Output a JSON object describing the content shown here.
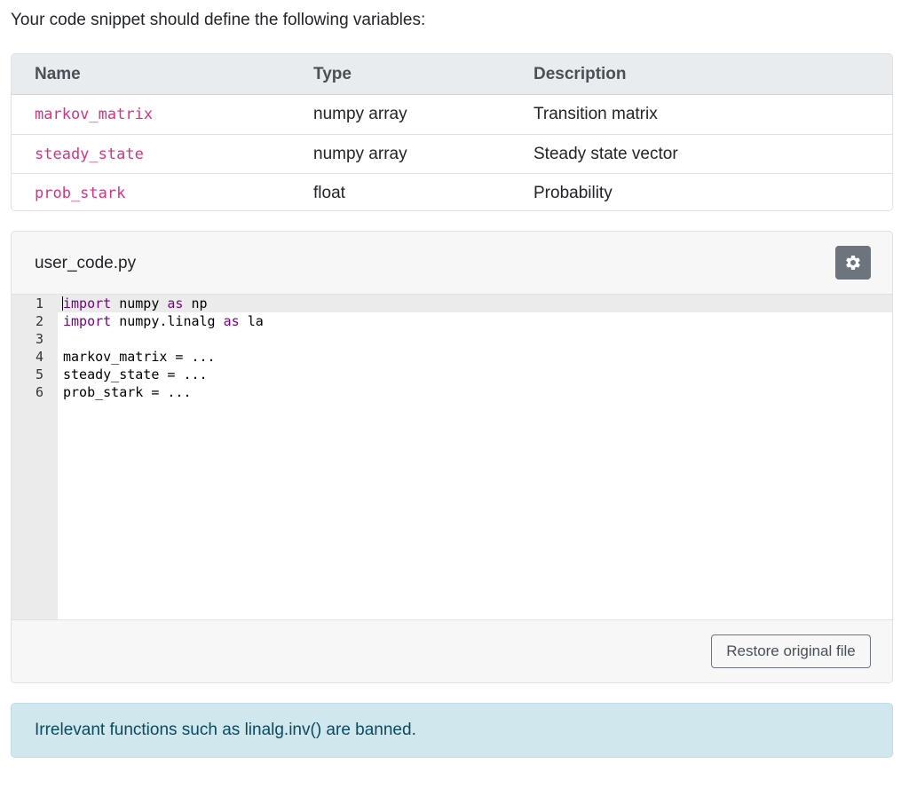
{
  "intro": "Your code snippet should define the following variables:",
  "variables_table": {
    "headers": [
      "Name",
      "Type",
      "Description"
    ],
    "rows": [
      [
        "markov_matrix",
        "numpy array",
        "Transition matrix"
      ],
      [
        "steady_state",
        "numpy array",
        "Steady state vector"
      ],
      [
        "prob_stark",
        "float",
        "Probability"
      ]
    ]
  },
  "editor": {
    "filename": "user_code.py",
    "settings_icon": "gear-icon",
    "line_numbers": [
      "1",
      "2",
      "3",
      "4",
      "5",
      "6"
    ],
    "lines": [
      {
        "kw1": "import",
        "mid": " numpy ",
        "kw2": "as",
        "tail": " np"
      },
      {
        "kw1": "import",
        "mid": " numpy.linalg ",
        "kw2": "as",
        "tail": " la"
      },
      {
        "kw1": "",
        "mid": "",
        "kw2": "",
        "tail": ""
      },
      {
        "kw1": "",
        "mid": "markov_matrix = ...",
        "kw2": "",
        "tail": ""
      },
      {
        "kw1": "",
        "mid": "steady_state = ...",
        "kw2": "",
        "tail": ""
      },
      {
        "kw1": "",
        "mid": "prob_stark = ...",
        "kw2": "",
        "tail": ""
      }
    ],
    "restore_label": "Restore original file"
  },
  "alert": "Irrelevant functions such as linalg.inv() are banned.",
  "colors": {
    "variable_name": "#d63384",
    "keyword": "#770088",
    "alert_bg": "#d1e7ee",
    "gear_button": "#6c757d"
  }
}
